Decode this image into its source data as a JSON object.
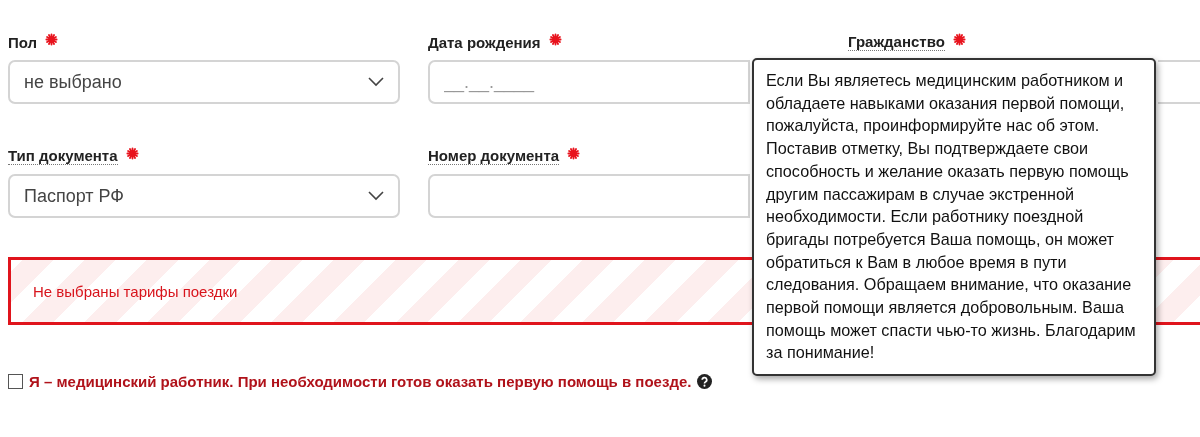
{
  "form_rows": [
    {
      "fields": [
        {
          "label": "Пол",
          "required": true,
          "has_hint": false,
          "kind": "select",
          "value": "не выбрано"
        },
        {
          "label": "Дата рождения",
          "required": true,
          "has_hint": false,
          "kind": "text",
          "placeholder": "__.__.____"
        },
        {
          "label": "Гражданство",
          "required": true,
          "has_hint": true,
          "kind": "text"
        }
      ]
    },
    {
      "fields": [
        {
          "label": "Тип документа",
          "required": true,
          "has_hint": true,
          "kind": "select",
          "value": "Паспорт РФ"
        },
        {
          "label": "Номер документа",
          "required": true,
          "has_hint": true,
          "kind": "text"
        }
      ]
    }
  ],
  "error_banner": {
    "text": "Не выбраны тарифы поездки"
  },
  "medic_checkbox": {
    "label": "Я – медицинский работник. При необходимости готов оказать первую помощь в поезде.",
    "checked": false
  },
  "tooltip": {
    "text": "Если Вы являетесь медицинским работником и обладаете навыками оказания первой помощи, пожалуйста, проинформируйте нас об этом. Поставив отметку, Вы подтверждаете свои способность и желание оказать первую помощь другим пассажирам в случае экстренной необходимости. Если работнику поездной бригады потребуется Ваша помощь, он может обратиться к Вам в любое время в пути следования. Обращаем внимание, что оказание первой помощи является добровольным. Ваша помощь может спасти чью-то жизнь. Благодарим за понимание!"
  }
}
